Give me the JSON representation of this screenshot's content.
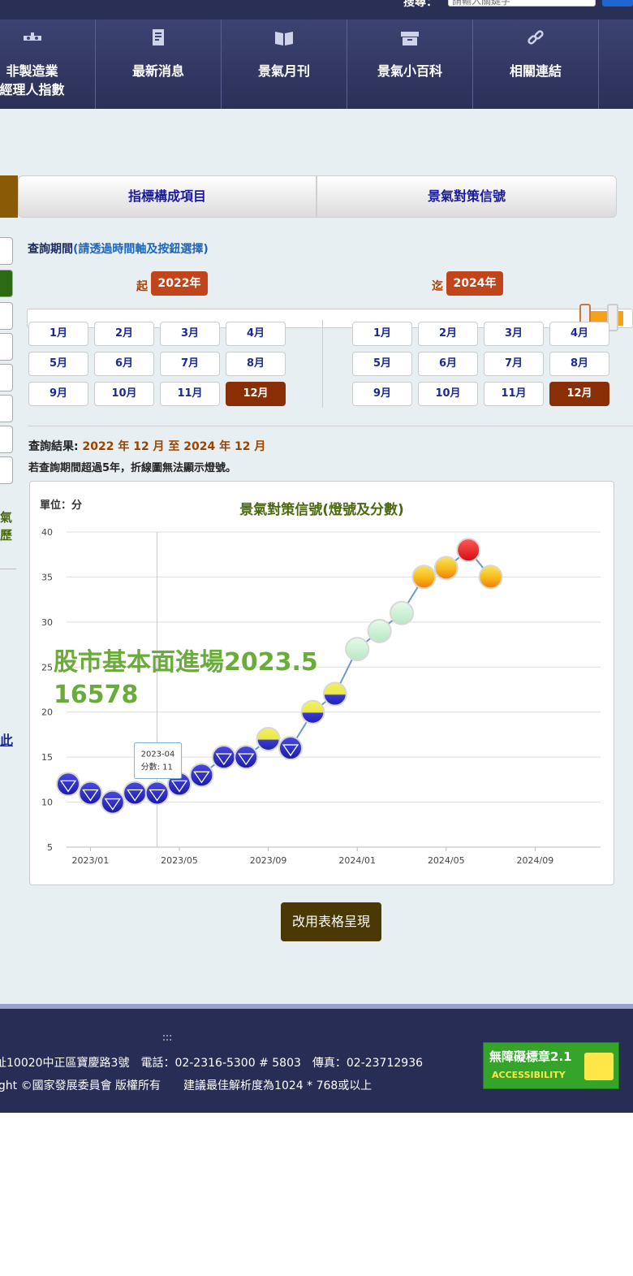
{
  "header": {
    "search_label": "搜尋：",
    "search_placeholder": "請輸入關鍵字"
  },
  "nav": {
    "items": [
      {
        "label": "非製造業\n經理人指數",
        "icon": "factory-icon"
      },
      {
        "label": "最新消息",
        "icon": "document-icon"
      },
      {
        "label": "景氣月刊",
        "icon": "book-icon"
      },
      {
        "label": "景氣小百科",
        "icon": "box-icon"
      },
      {
        "label": "相關連結",
        "icon": "link-icon"
      }
    ]
  },
  "tabs": {
    "items": [
      "指標構成項目",
      "景氣對策信號"
    ]
  },
  "query": {
    "period_title": "查詢期間",
    "period_note": "(請透過時間軸及按鈕選擇)",
    "start_label": "起",
    "start_year": "2022年",
    "end_label": "迄",
    "end_year": "2024年",
    "months": [
      "1月",
      "2月",
      "3月",
      "4月",
      "5月",
      "6月",
      "7月",
      "8月",
      "9月",
      "10月",
      "11月",
      "12月"
    ],
    "start_selected_month": "12月",
    "end_selected_month": "12月"
  },
  "result": {
    "label": "查詢結果:",
    "value": "2022 年 12 月 至 2024 年 12 月",
    "note": "若查詢期間超過5年，折線圖無法顯示燈號。"
  },
  "chart_data": {
    "type": "line",
    "title": "景氣對策信號(燈號及分數)",
    "unit_label": "單位：分",
    "ylim": [
      5,
      40
    ],
    "yticks": [
      5,
      10,
      15,
      20,
      25,
      30,
      35,
      40
    ],
    "xticks": [
      "2023/01",
      "2023/05",
      "2023/09",
      "2024/01",
      "2024/05",
      "2024/09"
    ],
    "x": [
      "2022/12",
      "2023/01",
      "2023/02",
      "2023/03",
      "2023/04",
      "2023/05",
      "2023/06",
      "2023/07",
      "2023/08",
      "2023/09",
      "2023/10",
      "2023/11",
      "2023/12",
      "2024/01",
      "2024/02",
      "2024/03",
      "2024/04",
      "2024/05",
      "2024/06",
      "2024/07"
    ],
    "values": [
      12,
      11,
      10,
      11,
      11,
      12,
      13,
      15,
      15,
      17,
      16,
      20,
      22,
      27,
      29,
      31,
      35,
      36,
      38,
      35
    ],
    "signals": [
      "blue",
      "blue",
      "blue",
      "blue",
      "blue",
      "blue",
      "blue",
      "blue",
      "blue",
      "yellow-blue",
      "blue",
      "yellow-blue",
      "yellow-blue",
      "green",
      "green",
      "green",
      "yellow-red",
      "yellow-red",
      "red",
      "yellow-red"
    ],
    "grid": true,
    "tooltip": {
      "date": "2023-04",
      "text": "分數: 11"
    },
    "colors": {
      "blue": "#2323c0",
      "yellow-blue": "#e8e84a",
      "green": "#c8f0d0",
      "yellow-red": "#f5c020",
      "red": "#e81c1c",
      "line": "#6a9ac8"
    }
  },
  "overlay": {
    "line1": "股市基本面進場2023.5",
    "line2": "16578"
  },
  "table_button": "改用表格呈現",
  "side": {
    "text": "氣\n歷",
    "link": "此"
  },
  "footer": {
    "dots": ":::",
    "line1": "址10020中正區寶慶路3號　電話：02-2316-5300 # 5803　傳真：02-23712936",
    "line2": "ight ©國家發展委員會 版權所有　　建議最佳解析度為1024 * 768或以上",
    "badge_line1": "無障礙標章2.1",
    "badge_line2": "ACCESSIBILITY"
  }
}
